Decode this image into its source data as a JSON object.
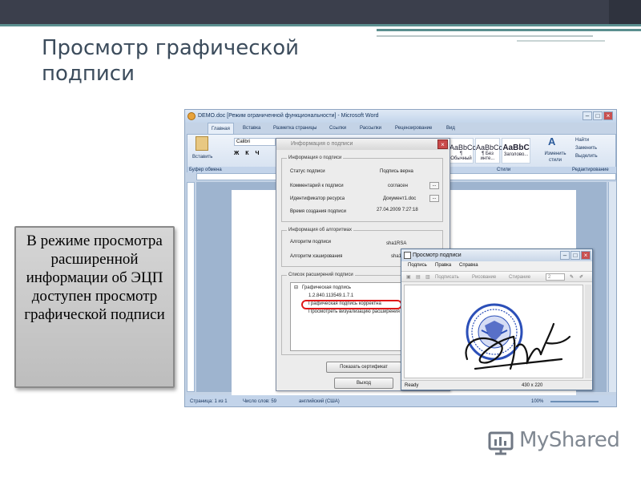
{
  "slide": {
    "title": "Просмотр графической подписи",
    "callout": "В режиме просмотра расширенной информации об ЭЦП доступен просмотр графической подписи"
  },
  "word": {
    "title": "DEMO.doc [Режим ограниченной функциональности] - Microsoft Word",
    "tabs": [
      "Главная",
      "Вставка",
      "Разметка страницы",
      "Ссылки",
      "Рассылки",
      "Рецензирование",
      "Вид"
    ],
    "ribbon": {
      "paste": "Вставить",
      "clipboard": "Буфер обмена",
      "font": "Calibri",
      "styles": [
        "AaBbCcDc",
        "AaBbCcDc",
        "AaBbC"
      ],
      "style_names": [
        "¶ Обычный",
        "¶ Без инте...",
        "Заголово..."
      ],
      "styles_label": "Стили",
      "change_styles": "Изменить стили",
      "find": "Найти",
      "replace": "Заменить",
      "select": "Выделить",
      "editing": "Редактирование"
    },
    "status": {
      "page": "Страница: 1 из 1",
      "words": "Число слов: 59",
      "language": "английский (США)",
      "zoom": "100%"
    }
  },
  "info_dialog": {
    "title": "Информация о подписи",
    "group1": "Информация о подписи",
    "rows1": [
      {
        "label": "Статус подписи",
        "value": "Подпись верна"
      },
      {
        "label": "Комментарий к подписи",
        "value": "согласен"
      },
      {
        "label": "Идентификатор ресурса",
        "value": "Документ1.doc"
      },
      {
        "label": "Время создания подписи",
        "value": "27.04.2009 7:27:18"
      }
    ],
    "group2": "Информация об алгоритмах",
    "rows2": [
      {
        "label": "Алгоритм подписи",
        "value": "sha1RSA"
      },
      {
        "label": "Алгоритм хэширования",
        "value": "sha1"
      }
    ],
    "group3": "Список расширений подписи",
    "tree": {
      "root": "Графическая подпись",
      "children": [
        "1.2.840.113549.1.7.1",
        "Графическая подпись корректна",
        "Просмотреть визуализацию расширения"
      ]
    },
    "buttons": {
      "show_cert": "Показать сертификат",
      "exit": "Выход"
    }
  },
  "preview_window": {
    "title": "Просмотр подписи",
    "menu": [
      "Подпись",
      "Правка",
      "Справка"
    ],
    "toolbar": {
      "sign": "Подписать",
      "draw": "Рисование",
      "erase": "Стирание",
      "width": "2"
    },
    "status": {
      "state": "Ready",
      "size": "430 x 220"
    }
  },
  "logo": {
    "text": "MyShared"
  }
}
